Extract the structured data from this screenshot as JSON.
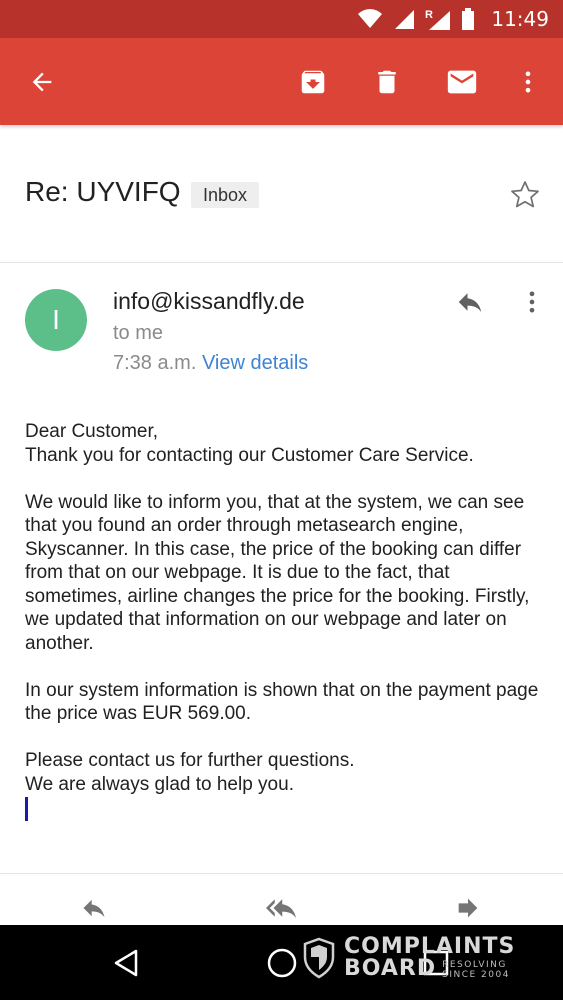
{
  "status_bar": {
    "time": "11:49",
    "icons": [
      "wifi-icon",
      "signal-icon",
      "roaming-signal-icon",
      "battery-icon"
    ],
    "color": "#b7322a"
  },
  "app_bar": {
    "color": "#db4437",
    "actions": [
      "back-arrow-icon",
      "archive-icon",
      "delete-icon",
      "mark-unread-icon",
      "more-vert-icon"
    ]
  },
  "email": {
    "subject": "Re: UYVIFQ",
    "label": "Inbox",
    "sender": {
      "avatar_letter": "I",
      "avatar_color": "#5cbf89",
      "email": "info@kissandfly.de",
      "recipient": "to me",
      "time": "7:38 a.m.",
      "view_details": "View details"
    },
    "body": {
      "greeting": "Dear Customer,",
      "line1": "Thank you for contacting our Customer Care Service.",
      "paragraph1": "We would like to inform you, that at the system, we can see that you found an order through metasearch engine, Skyscanner. In this case, the price of the booking can differ from that on our webpage. It is due to the fact, that sometimes, airline changes the price for the booking. Firstly, we updated that information on our webpage and later on another.",
      "paragraph2": "In our system information is shown that on the payment page the price was EUR 569.00.",
      "closing1": "Please contact us for further questions.",
      "closing2": "We are always glad to help you."
    }
  },
  "bottom_actions": [
    "reply-icon",
    "reply-all-icon",
    "forward-icon"
  ],
  "watermark": {
    "line1": "COMPLAINTS",
    "line2": "BOARD",
    "tag1": "RESOLVING",
    "tag2": "SINCE 2004"
  }
}
